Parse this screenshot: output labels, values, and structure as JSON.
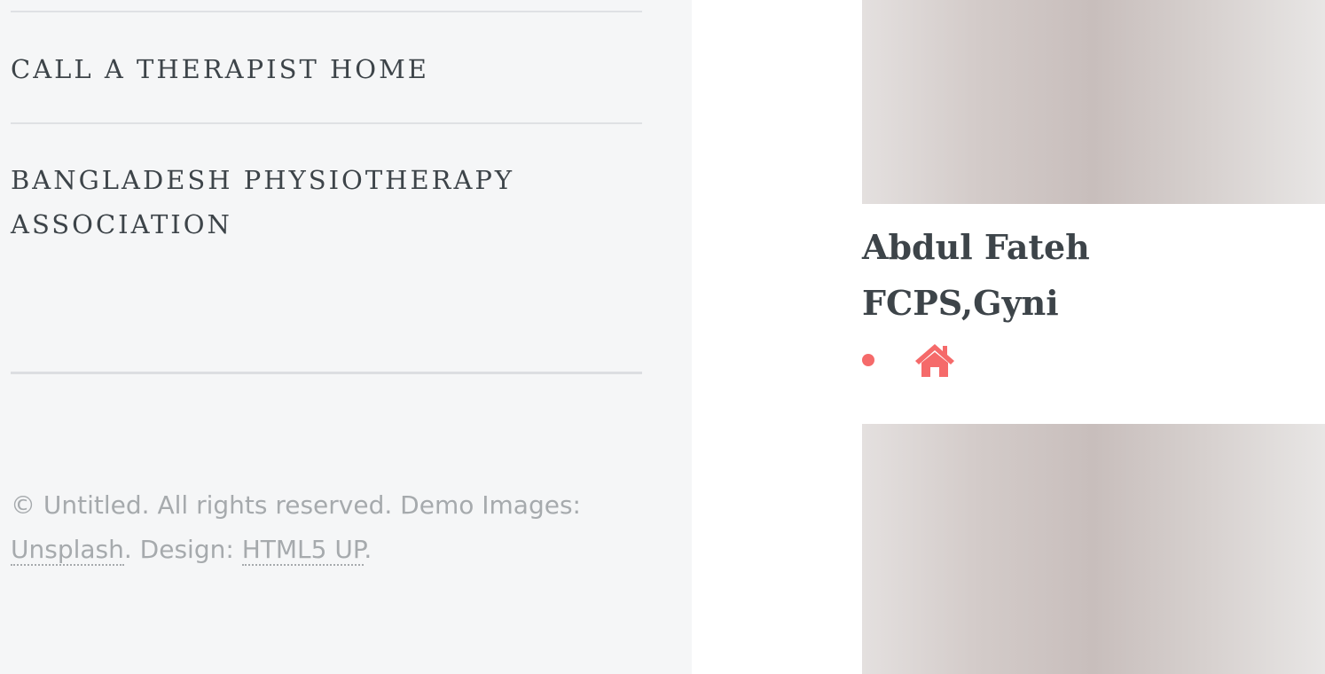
{
  "sidebar": {
    "menu": [
      {
        "label": "CALL A THERAPIST HOME"
      },
      {
        "label": "BANGLADESH PHYSIOTHERAPY ASSOCIATION"
      }
    ],
    "footer": {
      "prefix": "© Untitled. All rights reserved. Demo Images: ",
      "link1": "Unsplash",
      "middle": ". Design: ",
      "link2": "HTML5 UP",
      "suffix": "."
    }
  },
  "main": {
    "card": {
      "name": "Abdul Fateh",
      "degree": "FCPS,Gyni",
      "icons": [
        "bullet",
        "home-icon"
      ]
    }
  },
  "colors": {
    "accent": "#f56a6a",
    "text": "#3d4449",
    "muted": "#a6aaad",
    "sidebar_bg": "#f5f6f7"
  }
}
